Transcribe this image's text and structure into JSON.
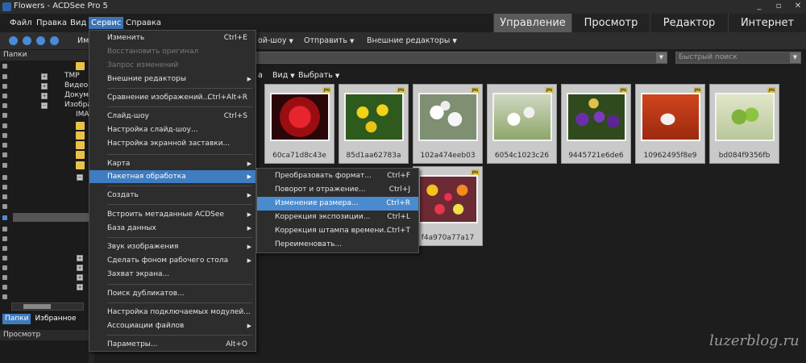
{
  "window": {
    "title": "Flowers - ACDSee Pro 5",
    "controls": [
      "_",
      "▫",
      "✕"
    ]
  },
  "menubar": [
    "Файл",
    "Правка",
    "Вид",
    "Сервис",
    "Справка"
  ],
  "modes": [
    "Управление",
    "Просмотр",
    "Редактор",
    "Интернет"
  ],
  "toolbar": {
    "partial_label": "Им",
    "slideshow": "ой-шоу",
    "send": "Отправить",
    "external_editors": "Внешние редакторы",
    "more_caret": "▾"
  },
  "left_panel": {
    "header": "Папки",
    "tree": [
      "TMP",
      "Видео",
      "Докуме",
      "Изобра",
      "IMA"
    ],
    "tabs": [
      "Папки",
      "Избранное"
    ],
    "preview_header": "Просмотр"
  },
  "search": {
    "placeholder": "Быстрый поиск"
  },
  "view_bar": {
    "prefix": "а",
    "view": "Вид",
    "select": "Выбрать"
  },
  "thumbnails": [
    {
      "caption": "60ca71d8c43e",
      "badge": "JPG"
    },
    {
      "caption": "85d1aa62783a",
      "badge": "JPG"
    },
    {
      "caption": "102a474eeb03",
      "badge": "JPG"
    },
    {
      "caption": "6054c1023c26",
      "badge": "JPG"
    },
    {
      "caption": "9445721e6de6",
      "badge": "JPG"
    },
    {
      "caption": "10962495f8e9",
      "badge": "JPG"
    },
    {
      "caption": "bd084f9356fb",
      "badge": "JPG"
    },
    {
      "caption": "f4a970a77a17",
      "badge": "JPG"
    }
  ],
  "service_menu": {
    "items": [
      {
        "label": "Изменить",
        "shortcut": "Ctrl+E"
      },
      {
        "label": "Восстановить оригинал",
        "disabled": true
      },
      {
        "label": "Запрос изменений",
        "disabled": true
      },
      {
        "label": "Внешние редакторы",
        "arrow": "▶"
      },
      {
        "label": "Сравнение изображений...",
        "shortcut": "Ctrl+Alt+R"
      },
      {
        "label": "Слайд-шоу",
        "shortcut": "Ctrl+S"
      },
      {
        "label": "Настройка слайд-шоу..."
      },
      {
        "label": "Настройка экранной заставки..."
      },
      {
        "label": "Карта",
        "arrow": "▶"
      },
      {
        "label": "Пакетная обработка",
        "arrow": "▶",
        "highlight": true
      },
      {
        "label": "Создать",
        "arrow": "▶"
      },
      {
        "label": "Встроить метаданные ACDSee",
        "arrow": "▶"
      },
      {
        "label": "База данных",
        "arrow": "▶"
      },
      {
        "label": "Звук изображения",
        "arrow": "▶"
      },
      {
        "label": "Сделать фоном рабочего стола",
        "arrow": "▶"
      },
      {
        "label": "Захват экрана..."
      },
      {
        "label": "Поиск дубликатов..."
      },
      {
        "label": "Настройка подключаемых модулей..."
      },
      {
        "label": "Ассоциации файлов",
        "arrow": "▶"
      },
      {
        "label": "Параметры...",
        "shortcut": "Alt+O"
      }
    ]
  },
  "batch_submenu": {
    "items": [
      {
        "label": "Преобразовать формат...",
        "shortcut": "Ctrl+F"
      },
      {
        "label": "Поворот и отражение...",
        "shortcut": "Ctrl+J"
      },
      {
        "label": "Изменение размера...",
        "shortcut": "Ctrl+R",
        "highlight": true
      },
      {
        "label": "Коррекция экспозиции...",
        "shortcut": "Ctrl+L"
      },
      {
        "label": "Коррекция штампа времени...",
        "shortcut": "Ctrl+T"
      },
      {
        "label": "Переименовать..."
      }
    ]
  },
  "watermark": "luzerblog.ru"
}
